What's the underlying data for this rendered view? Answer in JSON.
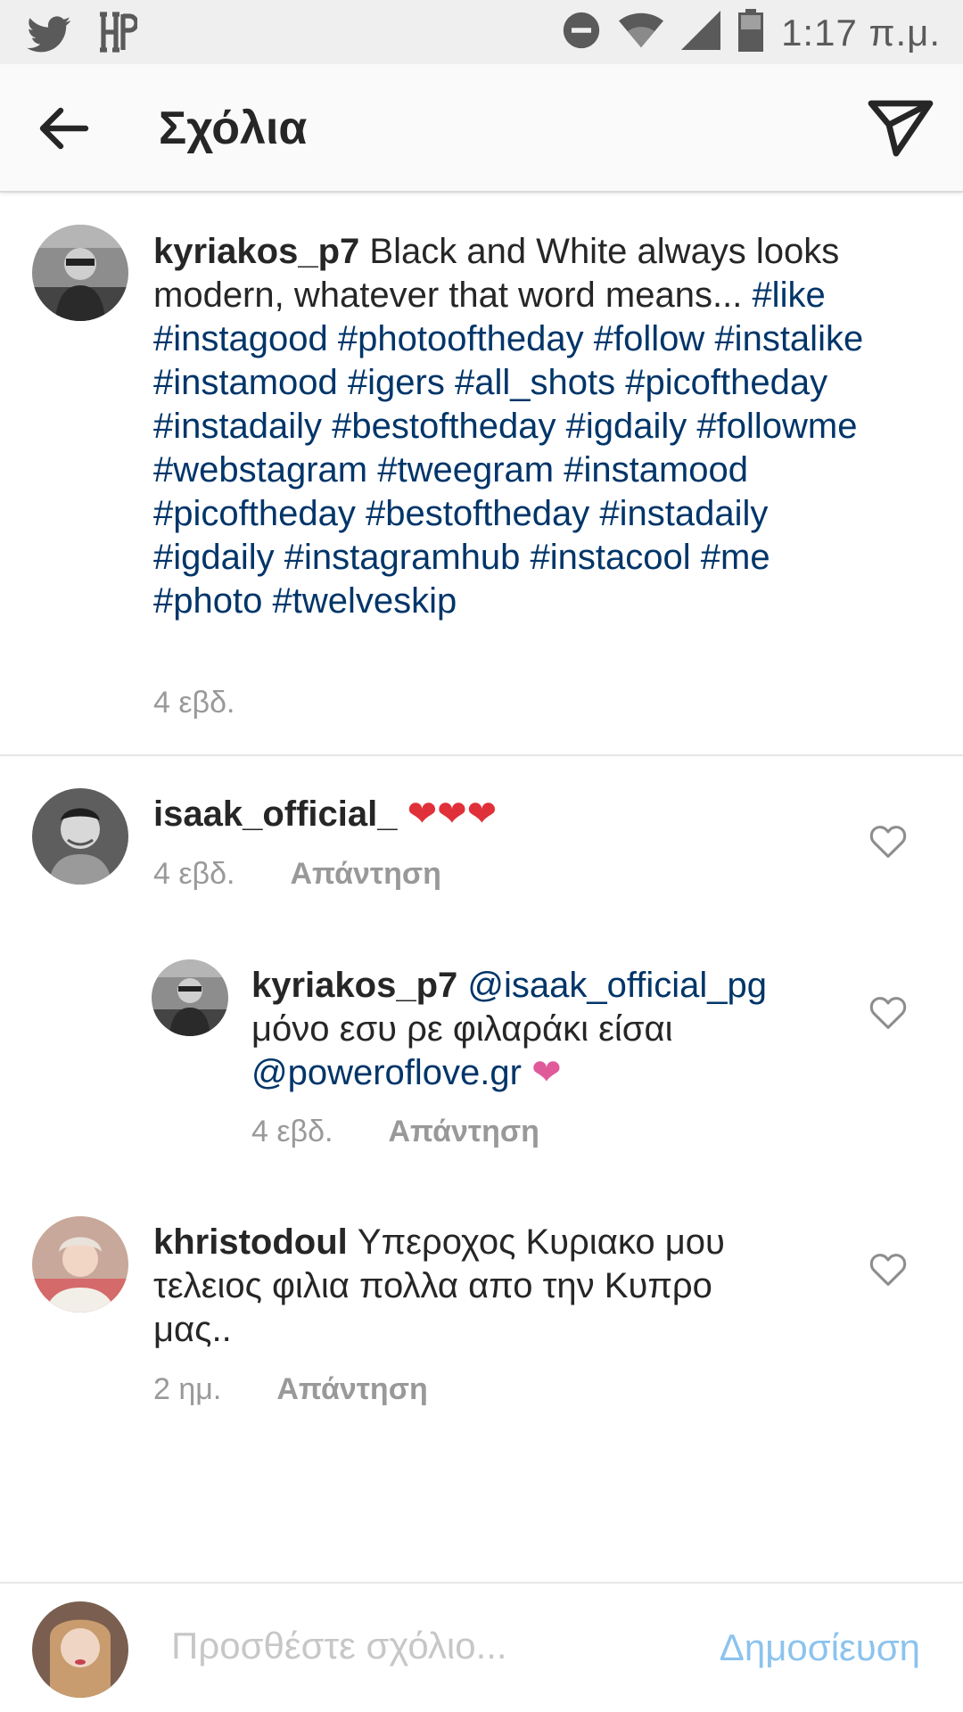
{
  "status_bar": {
    "time": "1:17 π.μ.",
    "left_icons": [
      "twitter-icon",
      "hp-icon"
    ],
    "right_icons": [
      "do-not-disturb-icon",
      "wifi-icon",
      "signal-icon",
      "battery-icon"
    ],
    "hp_logo_text": "HP"
  },
  "header": {
    "title": "Σχόλια"
  },
  "caption": {
    "username": "kyriakos_p7",
    "text": "Black and White always looks modern, whatever that word means...",
    "hashtags": [
      "#like",
      "#instagood",
      "#photooftheday",
      "#follow",
      "#instalike",
      "#instamood",
      "#igers",
      "#all_shots",
      "#picoftheday",
      "#instadaily",
      "#bestoftheday",
      "#igdaily",
      "#followme",
      "#webstagram",
      "#tweegram",
      "#instamood",
      "#picoftheday",
      "#bestoftheday",
      "#instadaily",
      "#igdaily",
      "#instagramhub",
      "#instacool",
      "#me",
      "#photo",
      "#twelveskip"
    ],
    "time": "4 εβδ."
  },
  "comments": [
    {
      "username": "isaak_official_",
      "text": "❤❤❤",
      "time": "4 εβδ.",
      "reply_label": "Απάντηση"
    },
    {
      "username": "kyriakos_p7",
      "mention": "@isaak_official_pg",
      "text": "μόνο εσυ ρε φιλαράκι είσαι",
      "mention2": "@poweroflove.gr",
      "emoji": "❤",
      "time": "4 εβδ.",
      "reply_label": "Απάντηση"
    },
    {
      "username": "khristodoul",
      "text_line1": "Υπεροχος Κυριακο μου",
      "text_line2": "τελειος φιλια πολλα απο την Κυπρο",
      "text_line3": "μας..",
      "time": "2 ημ.",
      "reply_label": "Απάντηση"
    }
  ],
  "composer": {
    "placeholder": "Προσθέστε σχόλιο...",
    "post_label": "Δημοσίευση"
  },
  "colors": {
    "hashtag": "#003569",
    "meta": "#999999",
    "post_button": "#8cc3ee",
    "heart": "#e0303a",
    "pink_heart": "#e05a9a"
  }
}
